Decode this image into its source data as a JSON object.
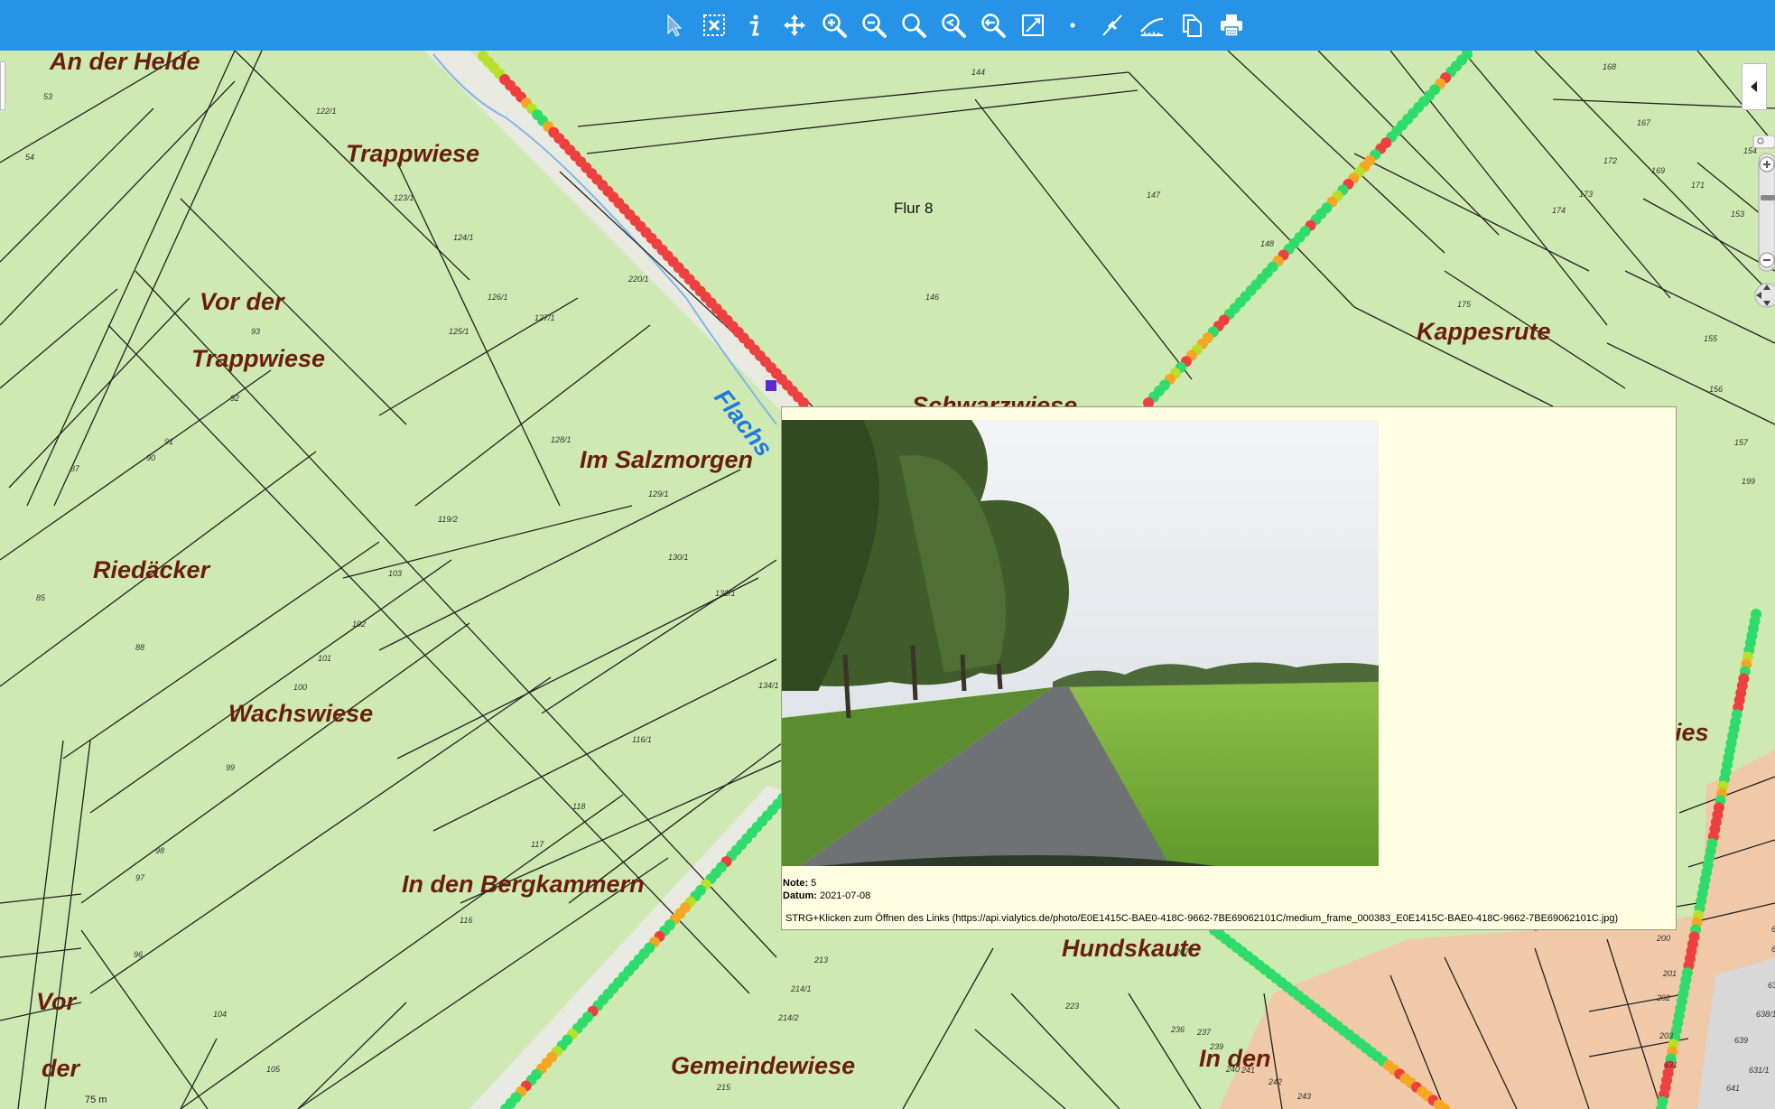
{
  "toolbar": {
    "tools": [
      {
        "name": "select-tool",
        "icon": "arrow-pointer-icon"
      },
      {
        "name": "clear-selection-tool",
        "icon": "box-x-icon"
      },
      {
        "name": "info-tool",
        "icon": "info-icon"
      },
      {
        "name": "pan-tool",
        "icon": "move-arrows-icon"
      },
      {
        "name": "zoom-in-tool",
        "icon": "zoom-in-icon"
      },
      {
        "name": "zoom-out-tool",
        "icon": "zoom-out-icon"
      },
      {
        "name": "zoom-full-tool",
        "icon": "magnifier-icon"
      },
      {
        "name": "zoom-previous-tool",
        "icon": "zoom-back-icon"
      },
      {
        "name": "zoom-next-tool",
        "icon": "zoom-forward-icon"
      },
      {
        "name": "measure-line-tool",
        "icon": "diagonal-box-icon"
      },
      {
        "name": "point-tool",
        "icon": "dot-icon"
      },
      {
        "name": "snap-tool",
        "icon": "pin-line-icon"
      },
      {
        "name": "measure-area-tool",
        "icon": "ruler-icon"
      },
      {
        "name": "copy-tool",
        "icon": "copy-icon"
      },
      {
        "name": "print-tool",
        "icon": "printer-icon"
      }
    ]
  },
  "map": {
    "field_names": {
      "an_der_helde": "An der Helde",
      "trappwiese": "Trappwiese",
      "vor_der": "Vor der",
      "vor_der_trappwiese": "Trappwiese",
      "im_salzmorgen": "Im Salzmorgen",
      "riedaecker": "Riedäcker",
      "wachswiese": "Wachswiese",
      "in_den_bergkammern": "In den Bergkammern",
      "vor": "Vor",
      "der": "der",
      "gemeindewiese": "Gemeindewiese",
      "in_den": "In den",
      "hundskaute": "Hundskaute",
      "kappesrute": "Kappesrute",
      "schwarzwiese": "Schwarzwiese",
      "ies": "ies",
      "flur": "Flur 8",
      "stream": "Flachs"
    },
    "parcel_numbers": [
      "53",
      "54",
      "122/1",
      "123/1",
      "124/1",
      "126/1",
      "127/1",
      "125/1",
      "220/1",
      "128/1",
      "93",
      "92",
      "91",
      "90",
      "87",
      "85",
      "119/2",
      "129/1",
      "130/1",
      "132/1",
      "103",
      "102",
      "101",
      "100",
      "99",
      "98",
      "97",
      "96",
      "88",
      "104",
      "105",
      "134/1",
      "116/1",
      "118",
      "117",
      "116",
      "213",
      "214/1",
      "214/2",
      "215",
      "223",
      "236",
      "237",
      "207",
      "239",
      "240",
      "241",
      "242",
      "243",
      "144",
      "146",
      "147",
      "148",
      "172",
      "173",
      "174",
      "175",
      "168",
      "167",
      "169",
      "171",
      "153",
      "154",
      "155",
      "156",
      "157",
      "199",
      "200",
      "201",
      "202",
      "203",
      "631",
      "633",
      "635",
      "637",
      "638/1",
      "639",
      "631/1",
      "641"
    ],
    "scale_label": "75 m",
    "street_quality_colors": {
      "good": "#2fdb6a",
      "medium": "#b8e02a",
      "fair": "#f5a623",
      "poor": "#ef4040"
    }
  },
  "popup": {
    "note_label": "Note:",
    "note_value": "5",
    "date_label": "Datum:",
    "date_value": "2021-07-08",
    "link_text": "STRG+Klicken zum Öffnen des Links (https://api.vialytics.de/photo/E0E1415C-BAE0-418C-9662-7BE69062101C/medium_frame_000383_E0E1415C-BAE0-418C-9662-7BE69062101C.jpg)"
  }
}
